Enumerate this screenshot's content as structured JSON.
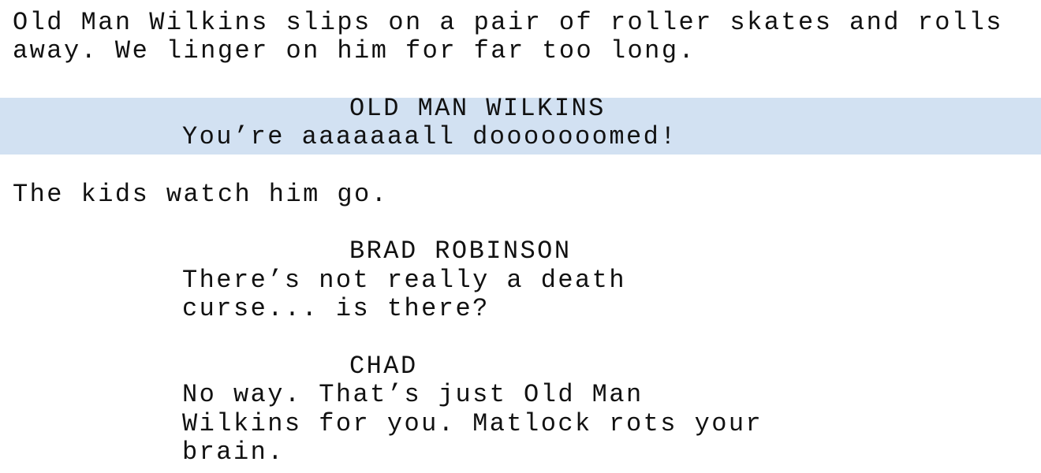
{
  "script": {
    "action_1": [
      "Old Man Wilkins slips on a pair of roller skates and rolls",
      "away. We linger on him for far too long."
    ],
    "highlighted_character": "OLD MAN WILKINS",
    "highlighted_dialogue": "You’re aaaaaaall dooooooomed!",
    "action_2": "The kids watch him go.",
    "character_2": "BRAD ROBINSON",
    "dialogue_2": [
      "There’s not really a death",
      "curse... is there?"
    ],
    "character_3": "CHAD",
    "dialogue_3": [
      "No way. That’s just Old Man",
      "Wilkins for you. Matlock rots your",
      "brain."
    ]
  },
  "colors": {
    "highlight": "#d2e1f2",
    "text": "#111111",
    "background": "#ffffff"
  }
}
